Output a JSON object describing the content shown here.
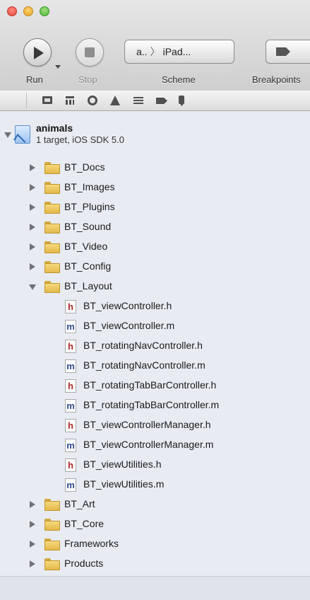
{
  "toolbar": {
    "run_label": "Run",
    "stop_label": "Stop",
    "scheme_label": "Scheme",
    "breakpoints_label": "Breakpoints",
    "scheme_target": "a..",
    "scheme_destination": "iPad..."
  },
  "project": {
    "name": "animals",
    "subtitle": "1 target, iOS SDK 5.0"
  },
  "tree": {
    "groups_top": [
      {
        "label": "BT_Docs"
      },
      {
        "label": "BT_Images"
      },
      {
        "label": "BT_Plugins"
      },
      {
        "label": "BT_Sound"
      },
      {
        "label": "BT_Video"
      },
      {
        "label": "BT_Config"
      }
    ],
    "layout_group": {
      "label": "BT_Layout"
    },
    "layout_files": [
      {
        "label": "BT_viewController.h",
        "type": "h"
      },
      {
        "label": "BT_viewController.m",
        "type": "m"
      },
      {
        "label": "BT_rotatingNavController.h",
        "type": "h"
      },
      {
        "label": "BT_rotatingNavController.m",
        "type": "m"
      },
      {
        "label": "BT_rotatingTabBarController.h",
        "type": "h"
      },
      {
        "label": "BT_rotatingTabBarController.m",
        "type": "m"
      },
      {
        "label": "BT_viewControllerManager.h",
        "type": "h"
      },
      {
        "label": "BT_viewControllerManager.m",
        "type": "m"
      },
      {
        "label": "BT_viewUtilities.h",
        "type": "h"
      },
      {
        "label": "BT_viewUtilities.m",
        "type": "m"
      }
    ],
    "groups_bottom": [
      {
        "label": "BT_Art"
      },
      {
        "label": "BT_Core"
      },
      {
        "label": "Frameworks"
      },
      {
        "label": "Products"
      }
    ]
  },
  "icons": {
    "h_letter": "h",
    "m_letter": "m"
  },
  "colors": {
    "sidebar_bg": "#e8ecf2",
    "header_file_letter": "#b02525",
    "impl_file_letter": "#2d4a8f",
    "folder": "#f6d87c"
  }
}
